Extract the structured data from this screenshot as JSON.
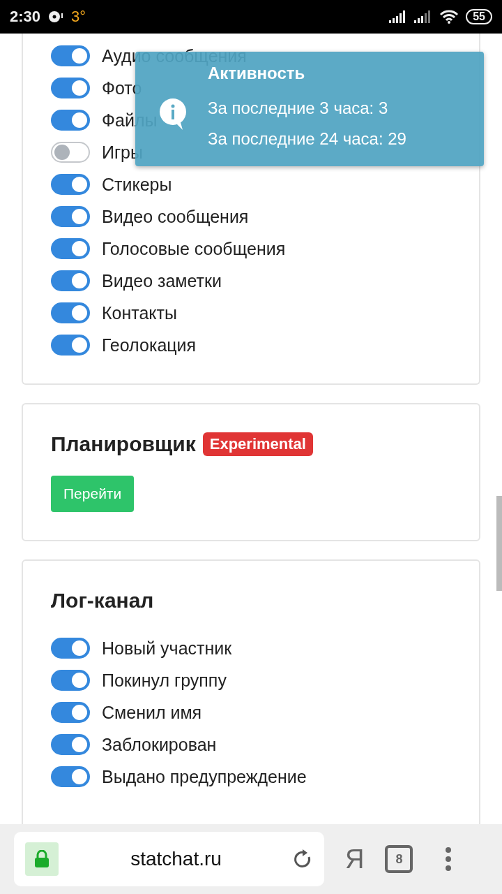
{
  "status_bar": {
    "time": "2:30",
    "temperature": "3°",
    "battery": "55"
  },
  "media_card": {
    "toggles": [
      {
        "label": "Аудио сообщения",
        "on": true
      },
      {
        "label": "Фото",
        "on": true
      },
      {
        "label": "Файлы",
        "on": true
      },
      {
        "label": "Игры",
        "on": false
      },
      {
        "label": "Стикеры",
        "on": true
      },
      {
        "label": "Видео сообщения",
        "on": true
      },
      {
        "label": "Голосовые сообщения",
        "on": true
      },
      {
        "label": "Видео заметки",
        "on": true
      },
      {
        "label": "Контакты",
        "on": true
      },
      {
        "label": "Геолокация",
        "on": true
      }
    ]
  },
  "scheduler_card": {
    "title": "Планировщик",
    "badge": "Experimental",
    "button": "Перейти"
  },
  "log_card": {
    "title": "Лог-канал",
    "toggles": [
      {
        "label": "Новый участник",
        "on": true
      },
      {
        "label": "Покинул группу",
        "on": true
      },
      {
        "label": "Сменил имя",
        "on": true
      },
      {
        "label": "Заблокирован",
        "on": true
      },
      {
        "label": "Выдано предупреждение",
        "on": true
      }
    ]
  },
  "toast": {
    "title": "Активность",
    "lines": [
      "За последние 3 часа: 3",
      "За последние 24 часа: 29"
    ]
  },
  "browser_bar": {
    "url": "statchat.ru",
    "browser_logo": "Я",
    "tab_count": "8"
  }
}
